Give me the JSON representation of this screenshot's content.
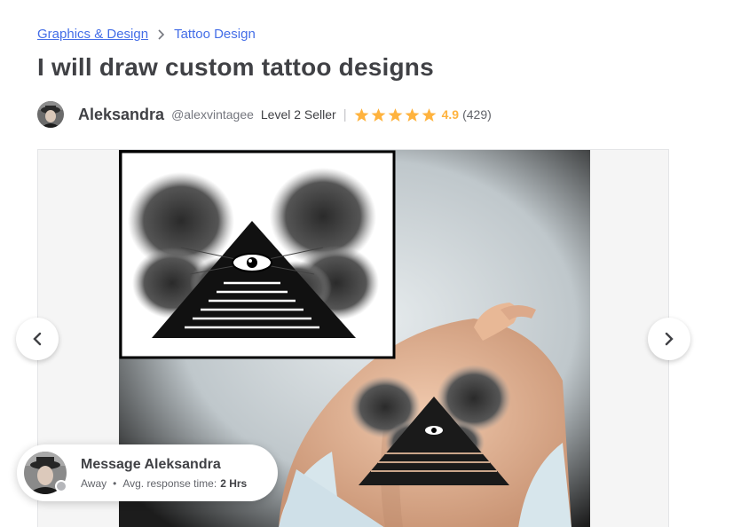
{
  "breadcrumb": {
    "category": "Graphics & Design",
    "subcategory": "Tattoo Design"
  },
  "gig": {
    "title": "I will draw custom tattoo designs"
  },
  "seller": {
    "name": "Aleksandra",
    "handle": "@alexvintagee",
    "level": "Level 2 Seller",
    "divider": "|",
    "rating": "4.9",
    "rating_stars": 5,
    "reviews": "(429)"
  },
  "gallery": {
    "prev_icon": "chevron-left-icon",
    "next_icon": "chevron-right-icon",
    "image_description_icon": "tattoo-design-image"
  },
  "chat": {
    "title": "Message Aleksandra",
    "status": "Away",
    "separator": "•",
    "response_label": "Avg. response time:",
    "response_value": "2 Hrs"
  },
  "colors": {
    "link": "#446ee7",
    "star": "#ffb33e",
    "text": "#404145",
    "muted": "#74767e"
  }
}
